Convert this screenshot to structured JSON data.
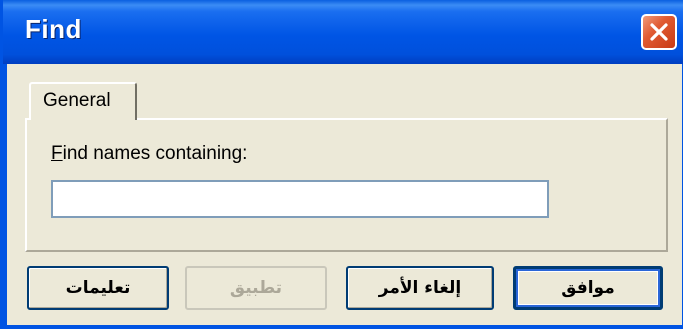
{
  "window": {
    "title": "Find"
  },
  "tabs": [
    {
      "label": "General"
    }
  ],
  "form": {
    "field_label_mnemonic": "F",
    "field_label_rest": "ind names containing:",
    "input_value": ""
  },
  "buttons": {
    "ok": "موافق",
    "cancel": "إلغاء الأمر",
    "apply": "تطبيق",
    "help": "تعليمات"
  },
  "colors": {
    "titlebar": "#0055e5",
    "close_button": "#e05a32",
    "dialog_background": "#ece9d8",
    "input_border": "#7f9db9",
    "button_border": "#003c74",
    "disabled_text": "#aca899"
  }
}
